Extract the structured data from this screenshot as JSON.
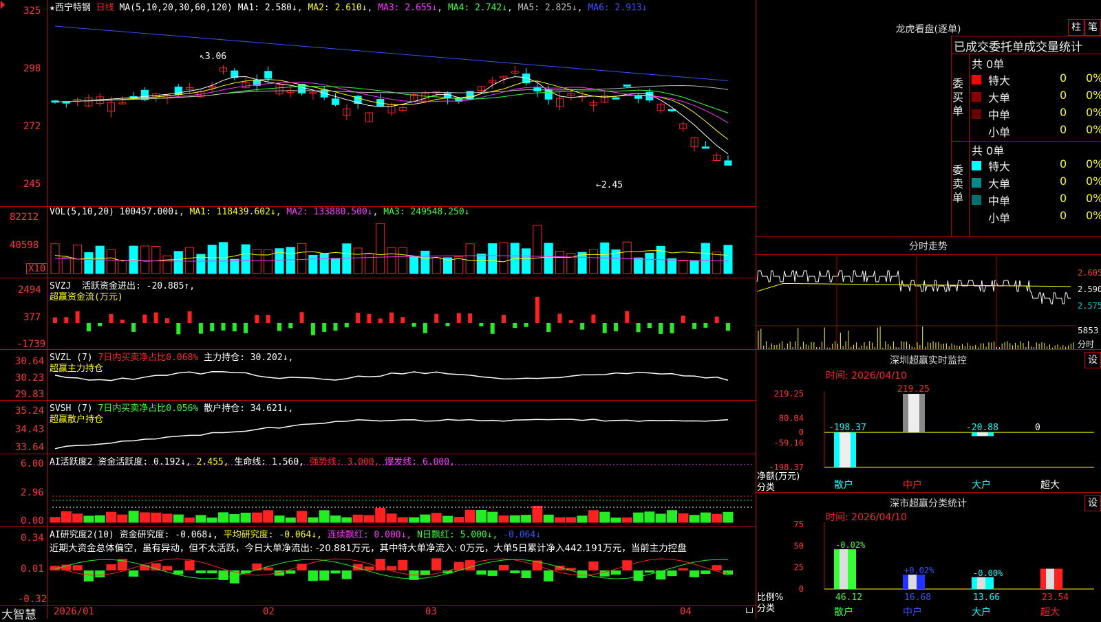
{
  "main_chart": {
    "title": "★西宁特钢",
    "period": "日线",
    "ma_header": "MA(5,10,20,30,60,120)",
    "ma": [
      "MA1: 2.580↓",
      "MA2: 2.610↓",
      "MA3: 2.655↓",
      "MA4: 2.742↓",
      "MA5: 2.825↓",
      "MA6: 2.913↓"
    ],
    "ma_colors": [
      "#ffffff",
      "#ffff00",
      "#ff33ff",
      "#33ff33",
      "#bbbbbb",
      "#3355ff"
    ],
    "y_ticks": [
      "325",
      "298",
      "272",
      "245"
    ],
    "high_label": "3.06",
    "low_label": "2.45"
  },
  "volume_panel": {
    "header": "VOL(5,10,20)",
    "value": "100457.000↓",
    "ma": [
      "MA1: 118439.602↓",
      "MA2: 133880.500↓",
      "MA3: 249548.250↓"
    ],
    "y_ticks": [
      "82212",
      "40598"
    ],
    "unit": "X10"
  },
  "svzj_panel": {
    "header": "SVZJ",
    "text": "活跃资金进出: -20.885↑,",
    "subtitle": "超赢资金流(万元)",
    "y_ticks": [
      "2494",
      "377",
      "-1739"
    ]
  },
  "svzl_panel": {
    "header": "SVZL (7)",
    "text": "7日内买卖净占比0.068%",
    "text2": "主力持仓: 30.202↓,",
    "subtitle": "超赢主力持仓",
    "y_ticks": [
      "30.64",
      "30.23",
      "29.83"
    ]
  },
  "svsh_panel": {
    "header": "SVSH (7)",
    "text": "7日内买卖净占比0.056%",
    "text2": "散户持仓: 34.621↓,",
    "subtitle": "超赢散户持仓",
    "y_ticks": [
      "35.24",
      "34.43",
      "33.64"
    ]
  },
  "ai_active_panel": {
    "header": "AI活跃度2",
    "items": [
      "资金活跃度: 0.192↓,",
      "2.455,",
      "生命线: 1.560,",
      "强势线: 3.000,",
      "爆发线: 6.000,"
    ],
    "y_ticks": [
      "6.00",
      "2.96",
      "0.00"
    ]
  },
  "ai_research_panel": {
    "header": "AI研究度2(10)",
    "items": [
      "资金研究度: -0.068↓,",
      "平均研究度: -0.064↓,",
      "连续飘红: 0.000↓,",
      "N日飘红: 5.000↓,",
      "-0.064↓"
    ],
    "comment": "近期大资金总体偏空，虽有异动，但不太活跃，今日大单净流出: -20.881万元，其中特大单净流入: 0万元，大单5日累计净入442.191万元，当前主力控盘",
    "y_ticks": [
      "0.34",
      "0.01",
      "-0.32"
    ]
  },
  "x_axis": {
    "logo": "大智慧",
    "dates": [
      "2026/01",
      "02",
      "03",
      "04"
    ]
  },
  "dragon_tiger": {
    "title": "龙虎看盘(逐单)",
    "tabs": [
      "柱",
      "笔"
    ],
    "heading": "已成交委托单成交量统计",
    "buy_group_label": "委买单",
    "sell_group_label": "委卖单",
    "buy_total": "共 0单",
    "sell_total": "共 0单",
    "buy_rows": [
      {
        "name": "特大",
        "count": "0",
        "pct": "0%",
        "color": "#ff0000"
      },
      {
        "name": "大单",
        "count": "0",
        "pct": "0%",
        "color": "#8b0000"
      },
      {
        "name": "中单",
        "count": "0",
        "pct": "0%",
        "color": "#6b0000"
      },
      {
        "name": "小单",
        "count": "0",
        "pct": "0%",
        "color": "#000000"
      }
    ],
    "sell_rows": [
      {
        "name": "特大",
        "count": "0",
        "pct": "0%",
        "color": "#00ffff"
      },
      {
        "name": "大单",
        "count": "0",
        "pct": "0%",
        "color": "#008b8b"
      },
      {
        "name": "中单",
        "count": "0",
        "pct": "0%",
        "color": "#007070"
      },
      {
        "name": "小单",
        "count": "0",
        "pct": "0%",
        "color": "#000000"
      }
    ]
  },
  "intraday": {
    "title": "分时走势",
    "y_ticks": [
      "2.605",
      "2.590",
      "2.575"
    ],
    "vol_tick": "5853",
    "vol_unit": "分时"
  },
  "sz_monitor": {
    "title": "深圳超赢实时监控",
    "settings": "设",
    "time_label": "时间: 2026/04/10",
    "y_ticks": [
      "219.25",
      "80.04",
      "0",
      "-59.16",
      "-198.37"
    ],
    "y_caption": "净额(万元)",
    "x_caption": "分类",
    "categories": [
      "散户",
      "中户",
      "大户",
      "超大"
    ],
    "values": [
      -198.37,
      219.25,
      -20.88,
      0
    ],
    "value_labels": [
      "-198.37",
      "219.25",
      "-20.88",
      "0"
    ]
  },
  "sz_classify": {
    "title": "深市超赢分类统计",
    "settings": "设",
    "time_label": "时间: 2026/04/10",
    "y_ticks": [
      "75",
      "50",
      "25",
      "0"
    ],
    "y_caption": "比例%",
    "x_caption": "分类",
    "categories": [
      "散户",
      "中户",
      "大户",
      "超大"
    ],
    "values": [
      46.12,
      16.68,
      13.66,
      23.54
    ],
    "value_labels": [
      "46.12",
      "16.68",
      "13.66",
      "23.54"
    ],
    "delta_labels": [
      "-0.02%",
      "+0.02%",
      "-0.00%",
      ""
    ]
  },
  "chart_data": [
    {
      "type": "bar",
      "title": "深圳超赢实时监控",
      "xlabel": "分类",
      "ylabel": "净额(万元)",
      "categories": [
        "散户",
        "中户",
        "大户",
        "超大"
      ],
      "values": [
        -198.37,
        219.25,
        -20.88,
        0
      ],
      "ylim": [
        -198.37,
        219.25
      ]
    },
    {
      "type": "bar",
      "title": "深市超赢分类统计",
      "xlabel": "分类",
      "ylabel": "比例%",
      "categories": [
        "散户",
        "中户",
        "大户",
        "超大"
      ],
      "values": [
        46.12,
        16.68,
        13.66,
        23.54
      ],
      "ylim": [
        0,
        75
      ]
    }
  ]
}
